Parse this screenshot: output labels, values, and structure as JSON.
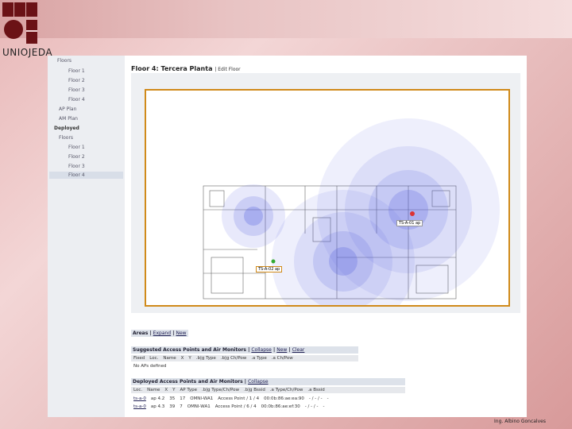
{
  "brand": {
    "logo_text": "UNIOJEDA",
    "author": "Ing. Albino Goncalves"
  },
  "sidebar": {
    "items": [
      {
        "label": "Floors"
      },
      {
        "label": "Floor 1"
      },
      {
        "label": "Floor 2"
      },
      {
        "label": "Floor 3"
      },
      {
        "label": "Floor 4"
      },
      {
        "label": "AP Plan"
      },
      {
        "label": "AM Plan"
      },
      {
        "label": "Deployed"
      },
      {
        "label": "Floors"
      },
      {
        "label": "Floor 1"
      },
      {
        "label": "Floor 2"
      },
      {
        "label": "Floor 3"
      },
      {
        "label": "Floor 4"
      }
    ]
  },
  "page": {
    "title": "Floor 4: Tercera Planta",
    "edit_link": "| Edit Floor"
  },
  "map": {
    "ap_labels": [
      "TS-A-01 ap",
      "TS-A-02 ap"
    ]
  },
  "areas": {
    "title": "Areas",
    "links": [
      "Expand",
      "New"
    ]
  },
  "suggested": {
    "title": "Suggested Access Points and Air Monitors",
    "links": [
      "Collapse",
      "New",
      "Clear"
    ],
    "columns": [
      "Fixed",
      "Loc.",
      "Name",
      "X",
      "Y",
      ".b|g Type",
      ".b|g Ch/Pow",
      ".a Type",
      ".a Ch/Pow"
    ],
    "empty": "No APs defined"
  },
  "deployed": {
    "title": "Deployed Access Points and Air Monitors",
    "links": [
      "Collapse"
    ],
    "columns": [
      "Loc.",
      "Name",
      "X",
      "Y",
      "AP Type",
      ".b|g Type/Ch/Pow",
      ".b|g Bssid",
      ".a Type/Ch/Pow",
      ".a Bssid"
    ],
    "rows": [
      [
        "ts-a-0",
        "ap 4.2",
        "35",
        "17",
        "OMNI-WA1",
        "Access Point / 1 / 4",
        "00:0b:86:ae:ea:90",
        "- / - / -",
        "-"
      ],
      [
        "ts-a-0",
        "ap 4.3",
        "39",
        "7",
        "OMNI-WA1",
        "Access Point / 6 / 4",
        "00:0b:86:ae:ef:30",
        "- / - / -",
        "-"
      ]
    ]
  },
  "colors": {
    "accent": "#d08a1a",
    "coverage": "#5a63e0"
  }
}
